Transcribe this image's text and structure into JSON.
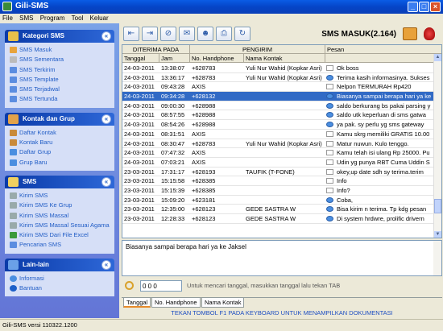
{
  "window": {
    "title": "Gili-SMS"
  },
  "menu": [
    "File",
    "SMS",
    "Program",
    "Tool",
    "Keluar"
  ],
  "sidebar": {
    "sections": [
      {
        "title": "Kategori SMS",
        "style": "dark",
        "items": [
          "SMS Masuk",
          "SMS Sementara",
          "SMS Terkirim",
          "SMS Template",
          "SMS Terjadwal",
          "SMS Tertunda"
        ]
      },
      {
        "title": "Kontak dan Grup",
        "style": "dark",
        "items": [
          "Daftar Kontak",
          "Kontak Baru",
          "Daftar Grup",
          "Grup Baru"
        ]
      },
      {
        "title": "SMS",
        "style": "dark",
        "items": [
          "Kirim SMS",
          "Kirim SMS Ke Grup",
          "Kirim SMS Massal",
          "Kirim SMS Massal Sesuai Agama",
          "Kirim SMS Dari File Excel",
          "Pencarian SMS"
        ]
      },
      {
        "title": "Lain-lain",
        "style": "dark",
        "items": [
          "Informasi",
          "Bantuan"
        ]
      }
    ]
  },
  "toolbar": {
    "title": "SMS MASUK(2.164)"
  },
  "grid": {
    "group_headers": {
      "received": "DITERIMA PADA",
      "sender": "PENGIRIM",
      "message": "Pesan"
    },
    "columns": {
      "date": "Tanggal",
      "time": "Jam",
      "phone": "No. Handphone",
      "contact": "Nama Kontak"
    },
    "selected_row": 3,
    "rows": [
      {
        "date": "24-03-2011",
        "time": "13:38:07",
        "phone": "+628783",
        "contact": "Yuli Nur Wahid (Kopkar Asri)",
        "message": "Ok boss",
        "icon": "env"
      },
      {
        "date": "24-03-2011",
        "time": "13:36:17",
        "phone": "+628783",
        "contact": "Yuli Nur Wahid (Kopkar Asri)",
        "message": "Terima kasih informasinya. Sukses",
        "icon": "blue"
      },
      {
        "date": "24-03-2011",
        "time": "09:43:28",
        "phone": "AXIS",
        "contact": "",
        "message": "Nelpon TERMURAH Rp420",
        "icon": "env"
      },
      {
        "date": "24-03-2011",
        "time": "09:34:28",
        "phone": "+628132",
        "contact": "",
        "message": "Biasanya sampai berapa hari ya ke",
        "icon": "blue"
      },
      {
        "date": "24-03-2011",
        "time": "09:00:30",
        "phone": "+628988",
        "contact": "",
        "message": "saldo berkurang bs pakai parsing y",
        "icon": "blue"
      },
      {
        "date": "24-03-2011",
        "time": "08:57:55",
        "phone": "+628988",
        "contact": "",
        "message": "saldo utk keperluan di sms gatwa",
        "icon": "blue"
      },
      {
        "date": "24-03-2011",
        "time": "08:54:26",
        "phone": "+628988",
        "contact": "",
        "message": "ya pak. sy perlu yg sms gateway",
        "icon": "blue"
      },
      {
        "date": "24-03-2011",
        "time": "08:31:51",
        "phone": "AXIS",
        "contact": "",
        "message": "Kamu skrg memiliki GRATIS 10.00",
        "icon": "env"
      },
      {
        "date": "24-03-2011",
        "time": "08:30:47",
        "phone": "+628783",
        "contact": "Yuli Nur Wahid (Kopkar Asri)",
        "message": "Matur nuwun. Kulo tenggo.",
        "icon": "env"
      },
      {
        "date": "24-03-2011",
        "time": "07:47:32",
        "phone": "AXIS",
        "contact": "",
        "message": "Kamu telah isi ulang Rp 25000. Pu",
        "icon": "env"
      },
      {
        "date": "24-03-2011",
        "time": "07:03:21",
        "phone": "AXIS",
        "contact": "",
        "message": "Udin yg punya RBT Cuma Uddin S",
        "icon": "env"
      },
      {
        "date": "23-03-2011",
        "time": "17:31:17",
        "phone": "+628193",
        "contact": "TAUFIK (T-FONE)",
        "message": "okey,up date sdh sy terima.terim",
        "icon": "env"
      },
      {
        "date": "23-03-2011",
        "time": "15:15:58",
        "phone": "+628385",
        "contact": "",
        "message": "Info",
        "icon": "env"
      },
      {
        "date": "23-03-2011",
        "time": "15:15:39",
        "phone": "+628385",
        "contact": "",
        "message": "Info?",
        "icon": "env"
      },
      {
        "date": "23-03-2011",
        "time": "15:09:20",
        "phone": "+623181",
        "contact": "",
        "message": "Coba,",
        "icon": "blue"
      },
      {
        "date": "23-03-2011",
        "time": "12:35:00",
        "phone": "+628123",
        "contact": "GEDE SASTRA W",
        "message": "Bisa kirim n terima. Tp kdg pesan",
        "icon": "blue"
      },
      {
        "date": "23-03-2011",
        "time": "12:28:33",
        "phone": "+628123",
        "contact": "GEDE SASTRA W",
        "message": "Di system hrdwre, prolific drivern",
        "icon": "blue"
      }
    ]
  },
  "preview": {
    "text": "Biasanya sampai berapa hari ya ke Jaksel"
  },
  "search": {
    "value": "0 0 0",
    "hint": "Untuk mencari tanggal, masukkan tanggal lalu tekan TAB"
  },
  "tabs": [
    "Tanggal",
    "No. Handphone",
    "Nama Kontak"
  ],
  "footer_note": "TEKAN TOMBOL F1 PADA KEYBOARD UNTUK MENAMPILKAN DOKUMENTASI",
  "status": {
    "text": "Gili-SMS versi 110322.1200"
  }
}
